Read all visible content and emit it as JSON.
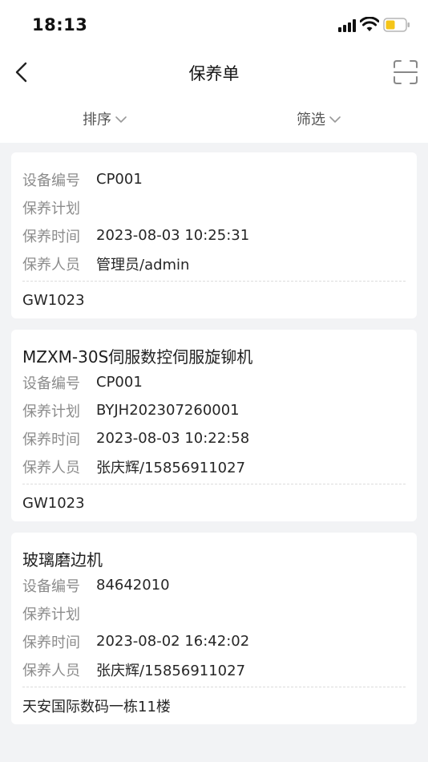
{
  "status_bar": {
    "time": "18:13"
  },
  "nav": {
    "title": "保养单"
  },
  "filters": {
    "sort_label": "排序",
    "filter_label": "筛选"
  },
  "labels": {
    "device_no": "设备编号",
    "plan": "保养计划",
    "time": "保养时间",
    "person": "保养人员"
  },
  "cards": [
    {
      "title": "",
      "device_no": "CP001",
      "plan": "",
      "time": "2023-08-03 10:25:31",
      "person": "管理员/admin",
      "location": "GW1023"
    },
    {
      "title": "MZXM-30S伺服数控伺服旋铆机",
      "device_no": "CP001",
      "plan": "BYJH202307260001",
      "time": "2023-08-03 10:22:58",
      "person": "张庆辉/15856911027",
      "location": "GW1023"
    },
    {
      "title": "玻璃磨边机",
      "device_no": "84642010",
      "plan": "",
      "time": "2023-08-02 16:42:02",
      "person": "张庆辉/15856911027",
      "location": "天安国际数码一栋11楼"
    }
  ],
  "colors": {
    "background": "#f2f3f5",
    "card": "#ffffff",
    "label_gray": "#8c8c8c",
    "battery_yellow": "#f5c518"
  },
  "icons": {
    "back": "chevron-left-icon",
    "scan": "scan-icon",
    "dropdown": "chevron-down-icon"
  }
}
